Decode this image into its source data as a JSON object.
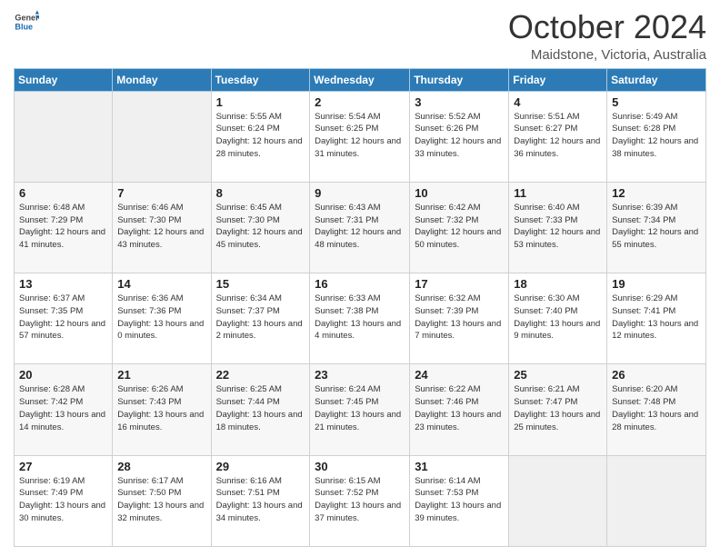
{
  "header": {
    "logo_general": "General",
    "logo_blue": "Blue",
    "month": "October 2024",
    "location": "Maidstone, Victoria, Australia"
  },
  "weekdays": [
    "Sunday",
    "Monday",
    "Tuesday",
    "Wednesday",
    "Thursday",
    "Friday",
    "Saturday"
  ],
  "weeks": [
    [
      {
        "day": "",
        "sunrise": "",
        "sunset": "",
        "daylight": ""
      },
      {
        "day": "",
        "sunrise": "",
        "sunset": "",
        "daylight": ""
      },
      {
        "day": "1",
        "sunrise": "Sunrise: 5:55 AM",
        "sunset": "Sunset: 6:24 PM",
        "daylight": "Daylight: 12 hours and 28 minutes."
      },
      {
        "day": "2",
        "sunrise": "Sunrise: 5:54 AM",
        "sunset": "Sunset: 6:25 PM",
        "daylight": "Daylight: 12 hours and 31 minutes."
      },
      {
        "day": "3",
        "sunrise": "Sunrise: 5:52 AM",
        "sunset": "Sunset: 6:26 PM",
        "daylight": "Daylight: 12 hours and 33 minutes."
      },
      {
        "day": "4",
        "sunrise": "Sunrise: 5:51 AM",
        "sunset": "Sunset: 6:27 PM",
        "daylight": "Daylight: 12 hours and 36 minutes."
      },
      {
        "day": "5",
        "sunrise": "Sunrise: 5:49 AM",
        "sunset": "Sunset: 6:28 PM",
        "daylight": "Daylight: 12 hours and 38 minutes."
      }
    ],
    [
      {
        "day": "6",
        "sunrise": "Sunrise: 6:48 AM",
        "sunset": "Sunset: 7:29 PM",
        "daylight": "Daylight: 12 hours and 41 minutes."
      },
      {
        "day": "7",
        "sunrise": "Sunrise: 6:46 AM",
        "sunset": "Sunset: 7:30 PM",
        "daylight": "Daylight: 12 hours and 43 minutes."
      },
      {
        "day": "8",
        "sunrise": "Sunrise: 6:45 AM",
        "sunset": "Sunset: 7:30 PM",
        "daylight": "Daylight: 12 hours and 45 minutes."
      },
      {
        "day": "9",
        "sunrise": "Sunrise: 6:43 AM",
        "sunset": "Sunset: 7:31 PM",
        "daylight": "Daylight: 12 hours and 48 minutes."
      },
      {
        "day": "10",
        "sunrise": "Sunrise: 6:42 AM",
        "sunset": "Sunset: 7:32 PM",
        "daylight": "Daylight: 12 hours and 50 minutes."
      },
      {
        "day": "11",
        "sunrise": "Sunrise: 6:40 AM",
        "sunset": "Sunset: 7:33 PM",
        "daylight": "Daylight: 12 hours and 53 minutes."
      },
      {
        "day": "12",
        "sunrise": "Sunrise: 6:39 AM",
        "sunset": "Sunset: 7:34 PM",
        "daylight": "Daylight: 12 hours and 55 minutes."
      }
    ],
    [
      {
        "day": "13",
        "sunrise": "Sunrise: 6:37 AM",
        "sunset": "Sunset: 7:35 PM",
        "daylight": "Daylight: 12 hours and 57 minutes."
      },
      {
        "day": "14",
        "sunrise": "Sunrise: 6:36 AM",
        "sunset": "Sunset: 7:36 PM",
        "daylight": "Daylight: 13 hours and 0 minutes."
      },
      {
        "day": "15",
        "sunrise": "Sunrise: 6:34 AM",
        "sunset": "Sunset: 7:37 PM",
        "daylight": "Daylight: 13 hours and 2 minutes."
      },
      {
        "day": "16",
        "sunrise": "Sunrise: 6:33 AM",
        "sunset": "Sunset: 7:38 PM",
        "daylight": "Daylight: 13 hours and 4 minutes."
      },
      {
        "day": "17",
        "sunrise": "Sunrise: 6:32 AM",
        "sunset": "Sunset: 7:39 PM",
        "daylight": "Daylight: 13 hours and 7 minutes."
      },
      {
        "day": "18",
        "sunrise": "Sunrise: 6:30 AM",
        "sunset": "Sunset: 7:40 PM",
        "daylight": "Daylight: 13 hours and 9 minutes."
      },
      {
        "day": "19",
        "sunrise": "Sunrise: 6:29 AM",
        "sunset": "Sunset: 7:41 PM",
        "daylight": "Daylight: 13 hours and 12 minutes."
      }
    ],
    [
      {
        "day": "20",
        "sunrise": "Sunrise: 6:28 AM",
        "sunset": "Sunset: 7:42 PM",
        "daylight": "Daylight: 13 hours and 14 minutes."
      },
      {
        "day": "21",
        "sunrise": "Sunrise: 6:26 AM",
        "sunset": "Sunset: 7:43 PM",
        "daylight": "Daylight: 13 hours and 16 minutes."
      },
      {
        "day": "22",
        "sunrise": "Sunrise: 6:25 AM",
        "sunset": "Sunset: 7:44 PM",
        "daylight": "Daylight: 13 hours and 18 minutes."
      },
      {
        "day": "23",
        "sunrise": "Sunrise: 6:24 AM",
        "sunset": "Sunset: 7:45 PM",
        "daylight": "Daylight: 13 hours and 21 minutes."
      },
      {
        "day": "24",
        "sunrise": "Sunrise: 6:22 AM",
        "sunset": "Sunset: 7:46 PM",
        "daylight": "Daylight: 13 hours and 23 minutes."
      },
      {
        "day": "25",
        "sunrise": "Sunrise: 6:21 AM",
        "sunset": "Sunset: 7:47 PM",
        "daylight": "Daylight: 13 hours and 25 minutes."
      },
      {
        "day": "26",
        "sunrise": "Sunrise: 6:20 AM",
        "sunset": "Sunset: 7:48 PM",
        "daylight": "Daylight: 13 hours and 28 minutes."
      }
    ],
    [
      {
        "day": "27",
        "sunrise": "Sunrise: 6:19 AM",
        "sunset": "Sunset: 7:49 PM",
        "daylight": "Daylight: 13 hours and 30 minutes."
      },
      {
        "day": "28",
        "sunrise": "Sunrise: 6:17 AM",
        "sunset": "Sunset: 7:50 PM",
        "daylight": "Daylight: 13 hours and 32 minutes."
      },
      {
        "day": "29",
        "sunrise": "Sunrise: 6:16 AM",
        "sunset": "Sunset: 7:51 PM",
        "daylight": "Daylight: 13 hours and 34 minutes."
      },
      {
        "day": "30",
        "sunrise": "Sunrise: 6:15 AM",
        "sunset": "Sunset: 7:52 PM",
        "daylight": "Daylight: 13 hours and 37 minutes."
      },
      {
        "day": "31",
        "sunrise": "Sunrise: 6:14 AM",
        "sunset": "Sunset: 7:53 PM",
        "daylight": "Daylight: 13 hours and 39 minutes."
      },
      {
        "day": "",
        "sunrise": "",
        "sunset": "",
        "daylight": ""
      },
      {
        "day": "",
        "sunrise": "",
        "sunset": "",
        "daylight": ""
      }
    ]
  ]
}
